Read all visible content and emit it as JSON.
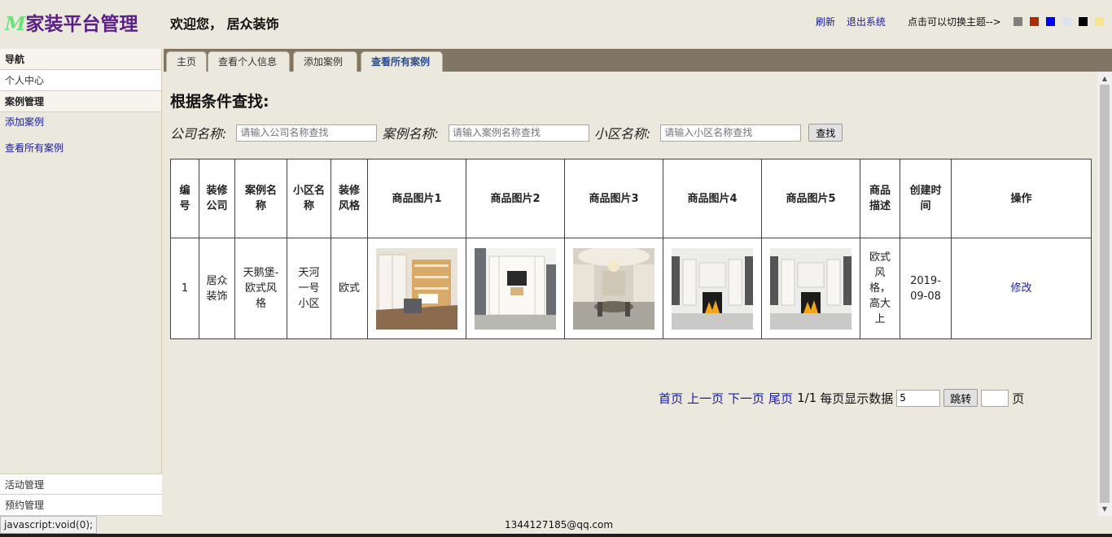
{
  "header": {
    "logo_mark": "M",
    "logo_text": "家装平台管理",
    "welcome": "欢迎您， 居众装饰",
    "links": [
      "刷新",
      "退出系统"
    ],
    "theme_hint": "点击可以切换主题-->",
    "theme_colors": [
      "#808080",
      "#b22a00",
      "#0000ff",
      "#d8e4f0",
      "#000000",
      "#f7e58c"
    ]
  },
  "sidebar": {
    "nav_title": "导航",
    "personal_center": "个人中心",
    "case_mgmt": "案例管理",
    "case_items": [
      "添加案例",
      "查看所有案例"
    ],
    "activity_mgmt": "活动管理",
    "booking_mgmt": "预约管理"
  },
  "tabs": [
    "主页",
    "查看个人信息",
    "添加案例",
    "查看所有案例"
  ],
  "search": {
    "title": "根据条件查找:",
    "company_label": "公司名称:",
    "company_placeholder": "请输入公司名称查找",
    "case_label": "案例名称:",
    "case_placeholder": "请输入案例名称查找",
    "community_label": "小区名称:",
    "community_placeholder": "请输入小区名称查找",
    "button": "查找"
  },
  "table": {
    "headers": [
      "编号",
      "装修公司",
      "案例名称",
      "小区名称",
      "装修风格",
      "商品图片1",
      "商品图片2",
      "商品图片3",
      "商品图片4",
      "商品图片5",
      "商品描述",
      "创建时间",
      "操作"
    ],
    "rows": [
      {
        "id": "1",
        "company": "居众装饰",
        "case_name": "天鹅堡-欧式风格",
        "community": "天河一号小区",
        "style": "欧式",
        "description": "欧式风格，高大上",
        "created": "2019-09-08",
        "action": "修改"
      }
    ]
  },
  "pager": {
    "first": "首页",
    "prev": "上一页",
    "next": "下一页",
    "last": "尾页",
    "page_info": "1/1",
    "per_page_label": "每页显示数据",
    "per_page_value": "5",
    "jump_button": "跳转",
    "page_suffix": "页"
  },
  "footer": {
    "email": "1344127185@qq.com",
    "status": "javascript:void(0);"
  }
}
